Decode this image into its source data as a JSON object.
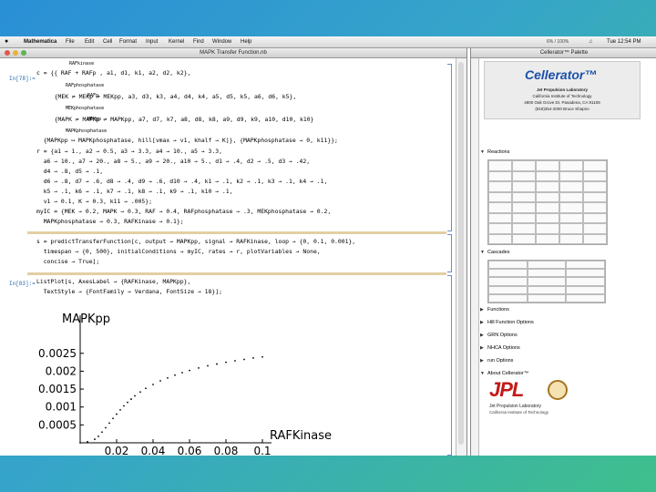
{
  "menubar": {
    "app": "Mathematica",
    "items": [
      "File",
      "Edit",
      "Cell",
      "Format",
      "Input",
      "Kernel",
      "Find",
      "Window",
      "Help"
    ],
    "status": "6% / 100%",
    "clock": "Tue 12:54 PM"
  },
  "notebook": {
    "title": "MAPK Transfer Function.nb",
    "in_labels": [
      "In[78]:=",
      "In[83]:="
    ],
    "cell1_lines": [
      "c = {{ RAF + RAFp , a1, d1, k1, a2, d2, k2},",
      "  {MEK ⇌ MEKp ⇌ MEKpp, a3, d3, k3, a4, d4, k4, a5, d5, k5, a6, d6, k5},",
      "  {MAPK ⇌ MAPKp ⇌ MAPKpp, a7, d7, k7, a8, d8, k8, a9, d9, k9, a10, d10, k10}",
      "  {MAPKpp ↦ MAPKphosphatase, hill[vmax → v1, khalf → K]}, {MAPKphosphatase → 0, k11}};",
      "r = {a1 → 1., a2 → 0.5, a3 → 3.3, a4 → 10., a5 → 3.3,",
      "  a6 → 10., a7 → 20., a8 → 5., a9 → 20., a10 → 5., d1 → .4, d2 → .5, d3 → .42,",
      "  d4 → .8, d5 → .1,",
      "  d6 → .8, d7 → .6, d8 → .4, d9 → .6, d10 → .4, k1 → .1, k2 → .1, k3 → .1, k4 → .1,",
      "  k5 → .1, k6 → .1, k7 → .1, k8 → .1, k9 → .1, k10 → .1,",
      "  v1 → 0.1, K → 0.3, k11 → .005};",
      "myIC = {MEK → 0.2, MAPK → 0.3, RAF → 0.4, RAFphosphatase → .3, MEKphosphatase → 0.2,",
      "  MAPKphosphatase → 0.3, RAFKinase → 0.1};"
    ],
    "cell1_annotations": {
      "rafkinase": "RAFkinase",
      "rafphos": "RAFphosphatase",
      "mekp": "RAFp",
      "mekphos": "MEKphosphatase",
      "mekpp": "MEKpp",
      "mapkphos": "MAPKphosphatase"
    },
    "cell2_lines": [
      "s = predictTransferFunction[c, output → MAPKpp, signal → RAFKinase, loop → {0, 0.1, 0.001},",
      "  timespan → {0, 500}, initialConditions → myIC, rates → r, plotVariables → None,",
      "  concise → True];"
    ],
    "cell3_lines": [
      "ListPlot[s, AxesLabel → {RAFKinase, MAPKpp},",
      "  TextStyle → {FontFamily → Verdana, FontSize → 18}];"
    ]
  },
  "chart_data": {
    "type": "scatter",
    "xlabel": "RAFKinase",
    "ylabel": "MAPKpp",
    "xticks": [
      "0.02",
      "0.04",
      "0.06",
      "0.08",
      "0.1"
    ],
    "yticks": [
      "0.0005",
      "0.001",
      "0.0015",
      "0.002",
      "0.0025"
    ],
    "xlim": [
      0,
      0.1
    ],
    "ylim": [
      0,
      0.0028
    ],
    "points": [
      [
        0.0,
        0.0
      ],
      [
        0.004,
        3e-05
      ],
      [
        0.008,
        0.0001
      ],
      [
        0.01,
        0.00018
      ],
      [
        0.012,
        0.0003
      ],
      [
        0.014,
        0.00042
      ],
      [
        0.016,
        0.00055
      ],
      [
        0.018,
        0.00068
      ],
      [
        0.02,
        0.0008
      ],
      [
        0.022,
        0.00092
      ],
      [
        0.024,
        0.00103
      ],
      [
        0.026,
        0.00113
      ],
      [
        0.028,
        0.00122
      ],
      [
        0.03,
        0.00131
      ],
      [
        0.033,
        0.00142
      ],
      [
        0.036,
        0.00152
      ],
      [
        0.04,
        0.00163
      ],
      [
        0.044,
        0.00173
      ],
      [
        0.048,
        0.00181
      ],
      [
        0.052,
        0.00189
      ],
      [
        0.056,
        0.00196
      ],
      [
        0.06,
        0.00202
      ],
      [
        0.065,
        0.00209
      ],
      [
        0.07,
        0.00215
      ],
      [
        0.075,
        0.0022
      ],
      [
        0.08,
        0.00225
      ],
      [
        0.085,
        0.00229
      ],
      [
        0.09,
        0.00233
      ],
      [
        0.095,
        0.00237
      ],
      [
        0.1,
        0.0024
      ]
    ]
  },
  "palette": {
    "title": "Cellerator™ Palette",
    "logo_name": "Cellerator™",
    "logo_sub": [
      "Jet Propulsion Laboratory",
      "California Institute of Technology",
      "4800 Oak Grove Dr. Pasadena, CA 91109",
      "(818)354-2000  Bruce Shapiro"
    ],
    "sections": {
      "reactions": "Reactions",
      "cascades": "Cascades",
      "functions": "Functions",
      "hill": "Hill Function Options",
      "grn": "GRN Options",
      "nhca": "NHCA Options",
      "run": "run Options",
      "about": "About Cellerator™"
    },
    "jpl": {
      "word": "JPL",
      "line1": "Jet Propulsion Laboratory",
      "line2": "California Institute of Technology"
    }
  }
}
